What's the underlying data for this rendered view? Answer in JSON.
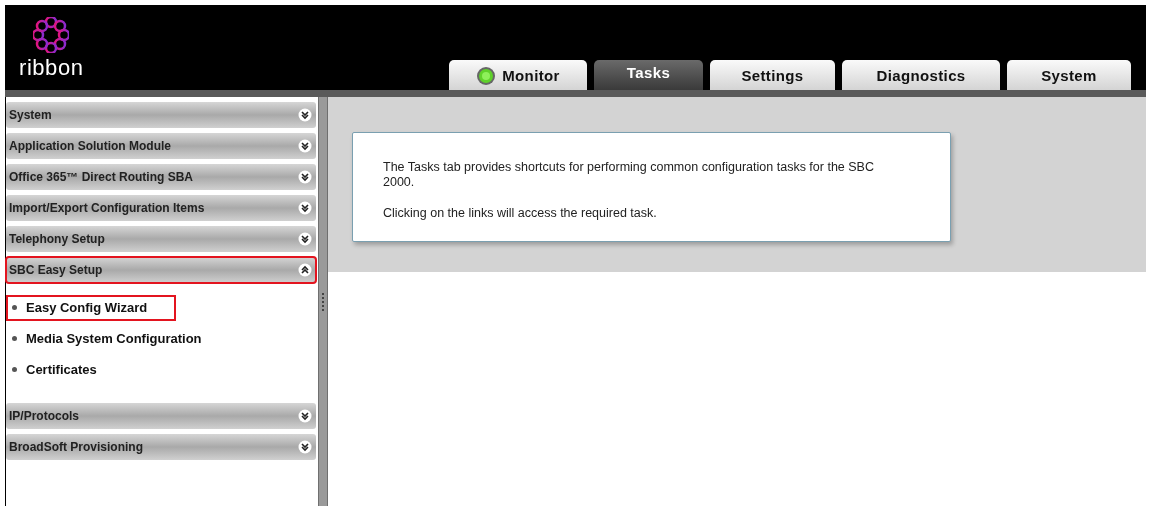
{
  "header": {
    "logo_text": "ribbon"
  },
  "tabs": [
    {
      "label": "Monitor",
      "selected": false,
      "kind": "status"
    },
    {
      "label": "Tasks",
      "selected": true,
      "kind": "plain"
    },
    {
      "label": "Settings",
      "selected": false,
      "kind": "plain"
    },
    {
      "label": "Diagnostics",
      "selected": false,
      "kind": "plain"
    },
    {
      "label": "System",
      "selected": false,
      "kind": "plain"
    }
  ],
  "sidebar": {
    "sections": [
      {
        "label": "System",
        "expanded": false,
        "highlighted": false
      },
      {
        "label": "Application Solution Module",
        "expanded": false,
        "highlighted": false
      },
      {
        "label": "Office 365™ Direct Routing SBA",
        "expanded": false,
        "highlighted": false
      },
      {
        "label": "Import/Export Configuration Items",
        "expanded": false,
        "highlighted": false
      },
      {
        "label": "Telephony Setup",
        "expanded": false,
        "highlighted": false
      },
      {
        "label": "SBC Easy Setup",
        "expanded": true,
        "highlighted": true,
        "children": [
          {
            "label": "Easy Config Wizard",
            "highlighted": true
          },
          {
            "label": "Media System Configuration",
            "highlighted": false
          },
          {
            "label": "Certificates",
            "highlighted": false
          }
        ]
      },
      {
        "label": "IP/Protocols",
        "expanded": false,
        "highlighted": false
      },
      {
        "label": "BroadSoft Provisioning",
        "expanded": false,
        "highlighted": false
      }
    ]
  },
  "info_panel": {
    "paragraphs": [
      "The Tasks tab provides shortcuts for performing common configuration tasks for the SBC 2000.",
      "Clicking on the links will access the required task."
    ]
  }
}
